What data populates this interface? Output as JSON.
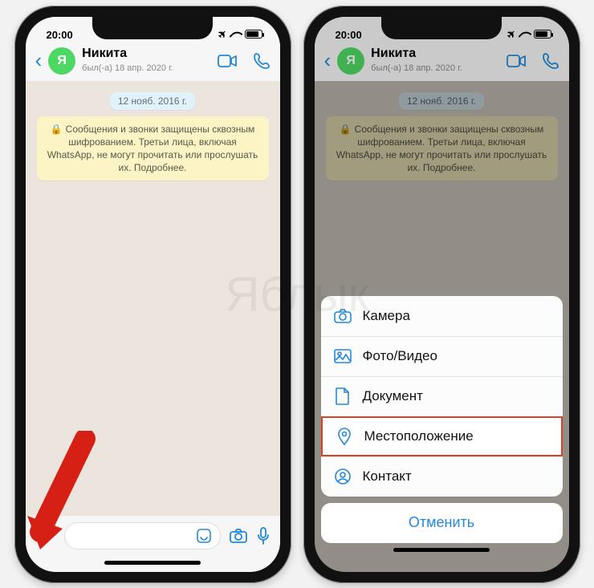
{
  "watermark": "Яблык",
  "statusbar": {
    "time": "20:00",
    "icons": {
      "plane": "✈"
    }
  },
  "chat": {
    "back_chevron": "‹",
    "avatar_letter": "Я",
    "name": "Никита",
    "subtitle": "был(-а) 18 апр. 2020 г.",
    "date_pill": "12 нояб. 2016 г.",
    "e2e_lock": "🔒",
    "e2e_text": "Сообщения и звонки защищены сквозным шифрованием. Третьи лица, включая WhatsApp, не могут прочитать или прослушать их. Подробнее.",
    "plus": "+"
  },
  "sheet": {
    "items": [
      {
        "label": "Камера"
      },
      {
        "label": "Фото/Видео"
      },
      {
        "label": "Документ"
      },
      {
        "label": "Местоположение"
      },
      {
        "label": "Контакт"
      }
    ],
    "cancel": "Отменить",
    "highlight_index": 3
  }
}
